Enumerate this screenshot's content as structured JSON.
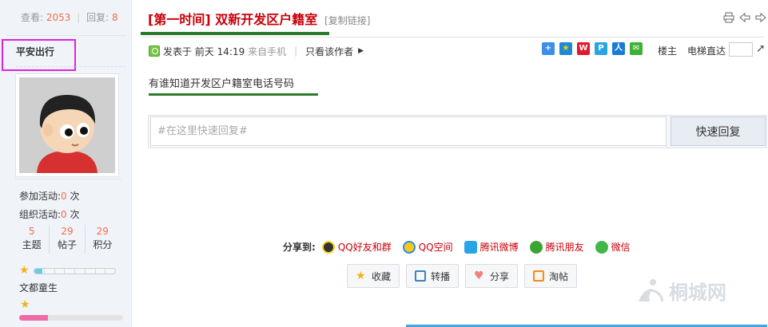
{
  "sidebar": {
    "views_label": "查看:",
    "views": "2053",
    "replies_label": "回复:",
    "replies": "8",
    "username": "平安出行",
    "activities": {
      "joined_label": "参加活动:",
      "joined": "0",
      "organized_label": "组织活动:",
      "organized": "0",
      "unit": "次"
    },
    "stats": [
      {
        "value": "5",
        "label": "主题"
      },
      {
        "value": "29",
        "label": "帖子"
      },
      {
        "value": "29",
        "label": "积分"
      }
    ],
    "rank": "文都童生",
    "progress_primary": 0.1,
    "progress_secondary": 0.28,
    "colors": {
      "accent_number": "#f26c4f",
      "progress_primary": "#67cde0",
      "progress_secondary": "#f06aa6",
      "highlight_box": "#e021e0"
    }
  },
  "post": {
    "title": "[第一时间] 双新开发区户籍室",
    "copy_link": "[复制链接]",
    "posted_prefix": "发表于",
    "posted_time": "前天 14:19",
    "source": "来自手机",
    "only_author": "只看该作者",
    "floor": "楼主",
    "elevator": "电梯直达",
    "content": "有谁知道开发区户籍室电话号码",
    "colors": {
      "title": "#c8000a",
      "underline": "#2d7a2d"
    }
  },
  "reply": {
    "placeholder": "#在这里快速回复#",
    "button": "快速回复"
  },
  "share": {
    "label": "分享到:",
    "items": [
      {
        "label": "QQ好友和群",
        "icon": "qq-icon"
      },
      {
        "label": "QQ空间",
        "icon": "qzone-icon"
      },
      {
        "label": "腾讯微博",
        "icon": "tencent-weibo-icon"
      },
      {
        "label": "腾讯朋友",
        "icon": "tencent-friends-icon"
      },
      {
        "label": "微信",
        "icon": "wechat-icon"
      }
    ]
  },
  "actions": [
    {
      "label": "收藏",
      "icon": "star-icon"
    },
    {
      "label": "转播",
      "icon": "rebroadcast-icon"
    },
    {
      "label": "分享",
      "icon": "heart-icon"
    },
    {
      "label": "淘帖",
      "icon": "tao-icon"
    }
  ],
  "watermark": "桐城网"
}
